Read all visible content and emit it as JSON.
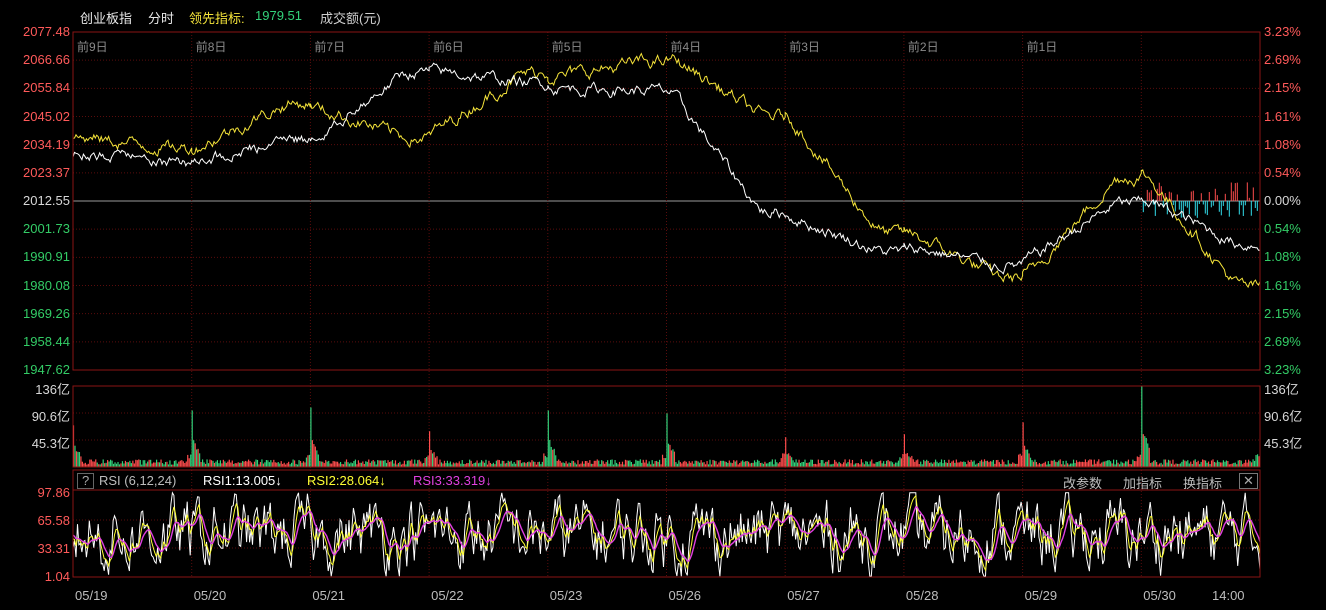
{
  "header": {
    "index_name": "创业板指",
    "mode": "分时",
    "lead_label": "领先指标:",
    "lead_value": "1979.51",
    "volume_label": "成交额(元)"
  },
  "price_axis": {
    "left_labels": [
      "2077.48",
      "2066.66",
      "2055.84",
      "2045.02",
      "2034.19",
      "2023.37",
      "2012.55",
      "2001.73",
      "1990.91",
      "1980.08",
      "1969.26",
      "1958.44",
      "1947.62"
    ],
    "right_labels": [
      "3.23%",
      "2.69%",
      "2.15%",
      "1.61%",
      "1.08%",
      "0.54%",
      "0.00%",
      "0.54%",
      "1.08%",
      "1.61%",
      "2.15%",
      "2.69%",
      "3.23%"
    ],
    "ymax": 2077.48,
    "ymin": 1947.62,
    "base": 2012.55
  },
  "day_labels": [
    "前9日",
    "前8日",
    "前7日",
    "前6日",
    "前5日",
    "前4日",
    "前3日",
    "前2日",
    "前1日"
  ],
  "x_labels": [
    "05/19",
    "05/20",
    "05/21",
    "05/22",
    "05/23",
    "05/26",
    "05/27",
    "05/28",
    "05/29",
    "05/30",
    "14:00"
  ],
  "volume_axis": {
    "labels": [
      "136亿",
      "90.6亿",
      "45.3亿"
    ],
    "max": 136
  },
  "rsi": {
    "name": "RSI (6,12,24)",
    "help": "?",
    "rsi1": "RSI1:13.005↓",
    "rsi2": "RSI2:28.064↓",
    "rsi3": "RSI3:33.319↓",
    "axis": [
      "97.86",
      "65.58",
      "33.31",
      "1.04"
    ],
    "buttons": [
      "改参数",
      "加指标",
      "换指标"
    ],
    "close": "✕"
  },
  "colors": {
    "price_line": "#ffffff",
    "lead_line": "#f5e43a",
    "up": "#ff4d4d",
    "down": "#33d17a",
    "cyan": "#33e0ee",
    "rsi1": "#ffffff",
    "rsi2": "#ffff33",
    "rsi3": "#e040e0",
    "grid": "#5a0c0c",
    "frame": "#8a1414",
    "left_label": "#ff5a5a",
    "left_label_low": "#33cc66"
  },
  "chart_data": [
    {
      "type": "line",
      "series": [
        {
          "name": "创业板指",
          "x": [
            "05/19",
            "05/20",
            "05/21",
            "05/22",
            "05/23",
            "05/26",
            "05/27",
            "05/28",
            "05/29",
            "05/30"
          ],
          "values": [
            2027,
            2036,
            2062,
            2058,
            2055,
            2008,
            1993,
            1988,
            2012,
            1996
          ]
        },
        {
          "name": "领先指标",
          "x": [
            "05/19",
            "05/20",
            "05/21",
            "05/22",
            "05/23",
            "05/26",
            "05/27",
            "05/28",
            "05/29",
            "05/30"
          ],
          "values": [
            2033,
            2050,
            2037,
            2062,
            2066,
            2045,
            2000,
            1983,
            2022,
            1979.51
          ]
        }
      ],
      "ylim": [
        1947.62,
        2077.48
      ]
    },
    {
      "type": "bar",
      "ylabel": "成交额(元)",
      "categories": [
        "05/19",
        "05/20",
        "05/21",
        "05/22",
        "05/23",
        "05/26",
        "05/27",
        "05/28",
        "05/29",
        "05/30"
      ],
      "opening_peaks": [
        70,
        95,
        100,
        60,
        95,
        90,
        50,
        55,
        75,
        136
      ],
      "ylim": [
        0,
        136
      ]
    },
    {
      "type": "line",
      "series": [
        {
          "name": "RSI1",
          "last": 13.005
        },
        {
          "name": "RSI2",
          "last": 28.064
        },
        {
          "name": "RSI3",
          "last": 33.319
        }
      ],
      "ylim": [
        1.04,
        97.86
      ]
    }
  ]
}
